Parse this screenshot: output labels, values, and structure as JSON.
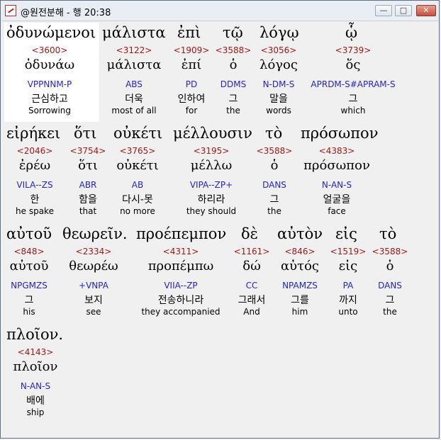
{
  "window": {
    "title": "@원전분해 - 행 20:38",
    "min_label": "—",
    "max_label": "□",
    "close_label": "✕"
  },
  "row1": {
    "words": [
      {
        "greek": "ὀδυνώμενοι",
        "strong": "<3600>",
        "lemma": "ὀδυνάω",
        "morph": "VPPNNM-P",
        "korean": "근심하고",
        "english": "Sorrowing"
      },
      {
        "greek": "μάλιστα",
        "strong": "<3122>",
        "lemma": "μάλιστα",
        "morph": "ABS",
        "korean": "더욱",
        "english": "most of all"
      },
      {
        "greek": "ἐπὶ",
        "strong": "<1909>",
        "lemma": "ἐπί",
        "morph": "PD",
        "korean": "인하여",
        "english": "for"
      },
      {
        "greek": "τῷ",
        "strong": "<3588>",
        "lemma": "ὁ",
        "morph": "DDMS",
        "korean": "그",
        "english": "the"
      },
      {
        "greek": "λόγῳ",
        "strong": "<3056>",
        "lemma": "λόγος",
        "morph": "N-DM-S",
        "korean": "말을",
        "english": "words"
      },
      {
        "greek": "ᾧ",
        "strong": "<3739>",
        "lemma": "ὅς",
        "morph": "APRDM-S#APRAM-S",
        "korean": "그",
        "english": "which"
      }
    ]
  },
  "row2": {
    "words": [
      {
        "greek": "εἰρήκει",
        "strong": "<2046>",
        "lemma": "ἐρέω",
        "morph": "VILA--ZS",
        "korean": "한",
        "english": "he spake"
      },
      {
        "greek": "ὅτι",
        "strong": "<3754>",
        "lemma": "ὅτι",
        "morph": "ABR",
        "korean": "함을",
        "english": "that"
      },
      {
        "greek": "οὐκέτι",
        "strong": "<3765>",
        "lemma": "οὐκέτι",
        "morph": "AB",
        "korean": "다시-못",
        "english": "no more"
      },
      {
        "greek": "μέλλουσιν",
        "strong": "<3195>",
        "lemma": "μέλλω",
        "morph": "VIPA--ZP+",
        "korean": "하리라",
        "english": "they should"
      },
      {
        "greek": "τὸ",
        "strong": "<3588>",
        "lemma": "ὁ",
        "morph": "DANS",
        "korean": "그",
        "english": "the"
      },
      {
        "greek": "πρόσωπον",
        "strong": "<4383>",
        "lemma": "πρόσωπον",
        "morph": "N-AN-S",
        "korean": "얼굴을",
        "english": "face"
      }
    ]
  },
  "row3": {
    "words": [
      {
        "greek": "αὐτοῦ",
        "strong": "<848>",
        "lemma": "αὐτοῦ",
        "morph": "NPGMZS",
        "korean": "그",
        "english": "his"
      },
      {
        "greek": "θεωρεῖν.",
        "strong": "<2334>",
        "lemma": "θεωρέω",
        "morph": "+VNPA",
        "korean": "보지",
        "english": "see"
      },
      {
        "greek": "προέπεμπον",
        "strong": "<4311>",
        "lemma": "προπέμπω",
        "morph": "VIIA--ZP",
        "korean": "전송하니라",
        "english": "they accompanied"
      },
      {
        "greek": "δὲ",
        "strong": "<1161>",
        "lemma": "δώ",
        "morph": "CC",
        "korean": "그래서",
        "english": "And"
      },
      {
        "greek": "αὐτὸν",
        "strong": "<846>",
        "lemma": "αὐτός",
        "morph": "NPAMZS",
        "korean": "그를",
        "english": "him"
      },
      {
        "greek": "εἰς",
        "strong": "<1519>",
        "lemma": "εἰς",
        "morph": "PA",
        "korean": "까지",
        "english": "unto"
      },
      {
        "greek": "τὸ",
        "strong": "<3588>",
        "lemma": "ὁ",
        "morph": "DANS",
        "korean": "그",
        "english": "the"
      }
    ]
  },
  "row4": {
    "words": [
      {
        "greek": "πλοῖον.",
        "strong": "<4143>",
        "lemma": "πλοῖον",
        "morph": "N-AN-S",
        "korean": "배에",
        "english": "ship"
      }
    ]
  },
  "colors": {
    "strong": "#a01818",
    "morph": "#2424c8",
    "highlight": "#ffffff"
  }
}
